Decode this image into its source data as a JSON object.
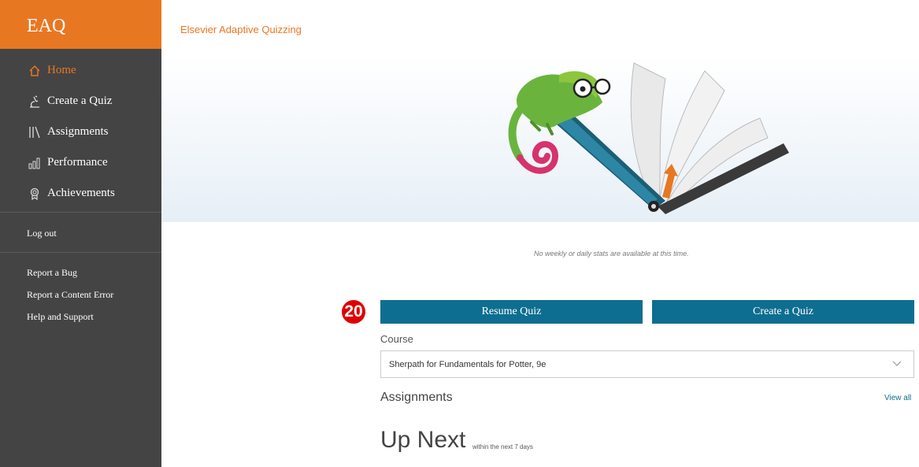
{
  "sidebar": {
    "logo": "EAQ",
    "nav": [
      {
        "label": "Home",
        "icon": "home-icon",
        "active": true
      },
      {
        "label": "Create a Quiz",
        "icon": "microscope-icon",
        "active": false
      },
      {
        "label": "Assignments",
        "icon": "books-icon",
        "active": false
      },
      {
        "label": "Performance",
        "icon": "bar-chart-icon",
        "active": false
      },
      {
        "label": "Achievements",
        "icon": "ribbon-icon",
        "active": false
      }
    ],
    "logout": "Log out",
    "links": [
      "Report a Bug",
      "Report a Content Error",
      "Help and Support"
    ]
  },
  "header": {
    "brand": "Elsevier Adaptive Quizzing"
  },
  "main": {
    "stats_message": "No weekly or daily stats are available at this time.",
    "step_badge": "20",
    "resume_button": "Resume Quiz",
    "create_button": "Create a Quiz",
    "course_label": "Course",
    "course_value": "Sherpath for Fundamentals for Potter, 9e",
    "assignments_title": "Assignments",
    "view_all": "View all",
    "up_next": "Up Next",
    "up_next_sub": "within the next 7 days"
  },
  "colors": {
    "accent": "#e87722",
    "primary": "#0e6e91",
    "sidebar": "#444444",
    "badge": "#e00000"
  }
}
